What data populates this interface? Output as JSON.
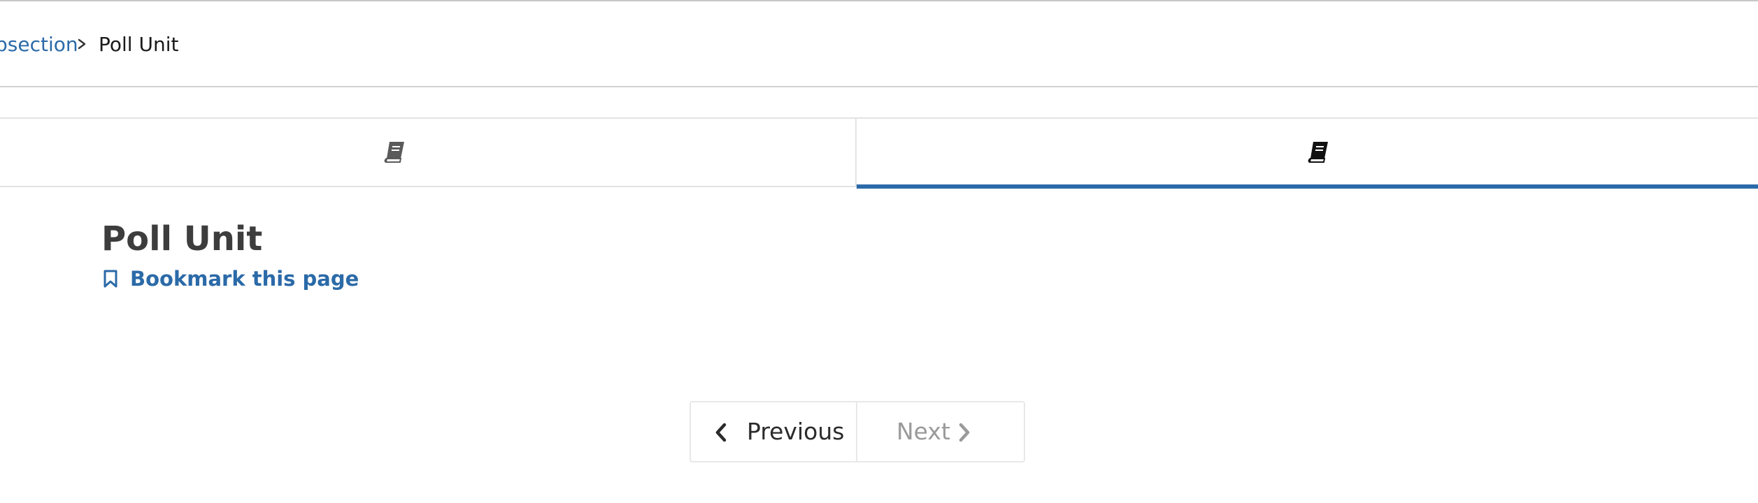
{
  "breadcrumb": {
    "parent_label": "psection",
    "separator_icon": "chevron-right-icon",
    "current_label": "Poll Unit"
  },
  "tabs": [
    {
      "icon": "book-icon",
      "active": false
    },
    {
      "icon": "book-icon",
      "active": true
    }
  ],
  "main": {
    "title": "Poll Unit",
    "bookmark_label": "Bookmark this page",
    "bookmark_icon": "bookmark-icon"
  },
  "pagination": {
    "previous_label": "Previous",
    "next_label": "Next",
    "next_disabled": true
  },
  "colors": {
    "link": "#2b6aa8",
    "active_tab_bar": "#2b6aa8",
    "title_text": "#3d3d3d",
    "disabled_text": "#9a9a9a"
  }
}
